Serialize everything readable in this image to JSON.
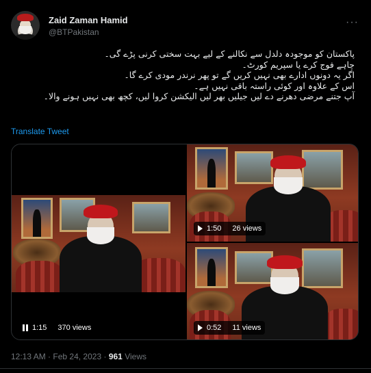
{
  "author": {
    "display_name": "Zaid Zaman Hamid",
    "handle": "@BTPakistan"
  },
  "more_icon": "more-horizontal-icon",
  "tweet": {
    "lines": [
      "پاکستان کو موجودہ دلدل سے نکالنے کے لیے بہت سختی کرنی پڑے گی۔",
      "چاہے فوج کرے یا سپریم کورٹ۔",
      "اگر یہ دونوں ادارے بھی نہیں کریں گے تو پھر نرندر مودی کرے گا۔",
      "اس کے علاوہ اور کوئی راستہ باقی نہیں ہے۔",
      "آپ جتنے مرضی دھرنے دے لیں جیلیں بھر لیں الیکشن کروا لیں، کچھ بھی نہیں ہونے والا۔"
    ],
    "translate_label": "Translate Tweet"
  },
  "media": {
    "videos": [
      {
        "time": "1:15",
        "views": "370 views",
        "state": "pause"
      },
      {
        "time": "1:50",
        "views": "26 views",
        "state": "play"
      },
      {
        "time": "0:52",
        "views": "11 views",
        "state": "play"
      }
    ]
  },
  "meta": {
    "time": "12:13 AM",
    "separator": "·",
    "date": "Feb 24, 2023",
    "views_count": "961",
    "views_label": "Views"
  },
  "colors": {
    "background": "#000000",
    "link": "#1d9bf0",
    "secondary_text": "#71767b",
    "beret": "#c0171c"
  }
}
